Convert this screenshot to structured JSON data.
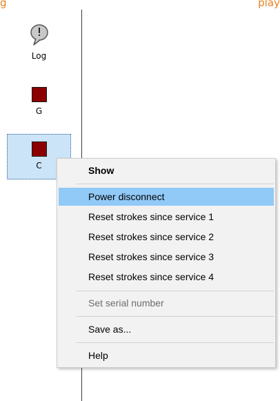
{
  "caption": {
    "left": "g",
    "right": "play"
  },
  "sidebar": {
    "items": [
      {
        "label": "Log",
        "icon": "speech-bubble-exclamation"
      },
      {
        "label": "G",
        "icon": "red-square",
        "color": "#8b0000"
      },
      {
        "label": "C",
        "icon": "red-square",
        "color": "#8b0000",
        "selected": true
      }
    ]
  },
  "context_menu": {
    "items": [
      {
        "label": "Show",
        "bold": true
      },
      {
        "label": "Power disconnect",
        "highlighted": true
      },
      {
        "label": "Reset strokes since service 1"
      },
      {
        "label": "Reset strokes since service 2"
      },
      {
        "label": "Reset strokes since service 3"
      },
      {
        "label": "Reset strokes since service 4"
      },
      {
        "label": "Set serial number",
        "disabled": true
      },
      {
        "label": "Save as..."
      },
      {
        "label": "Help"
      }
    ],
    "highlight_color": "#91c9f7"
  }
}
